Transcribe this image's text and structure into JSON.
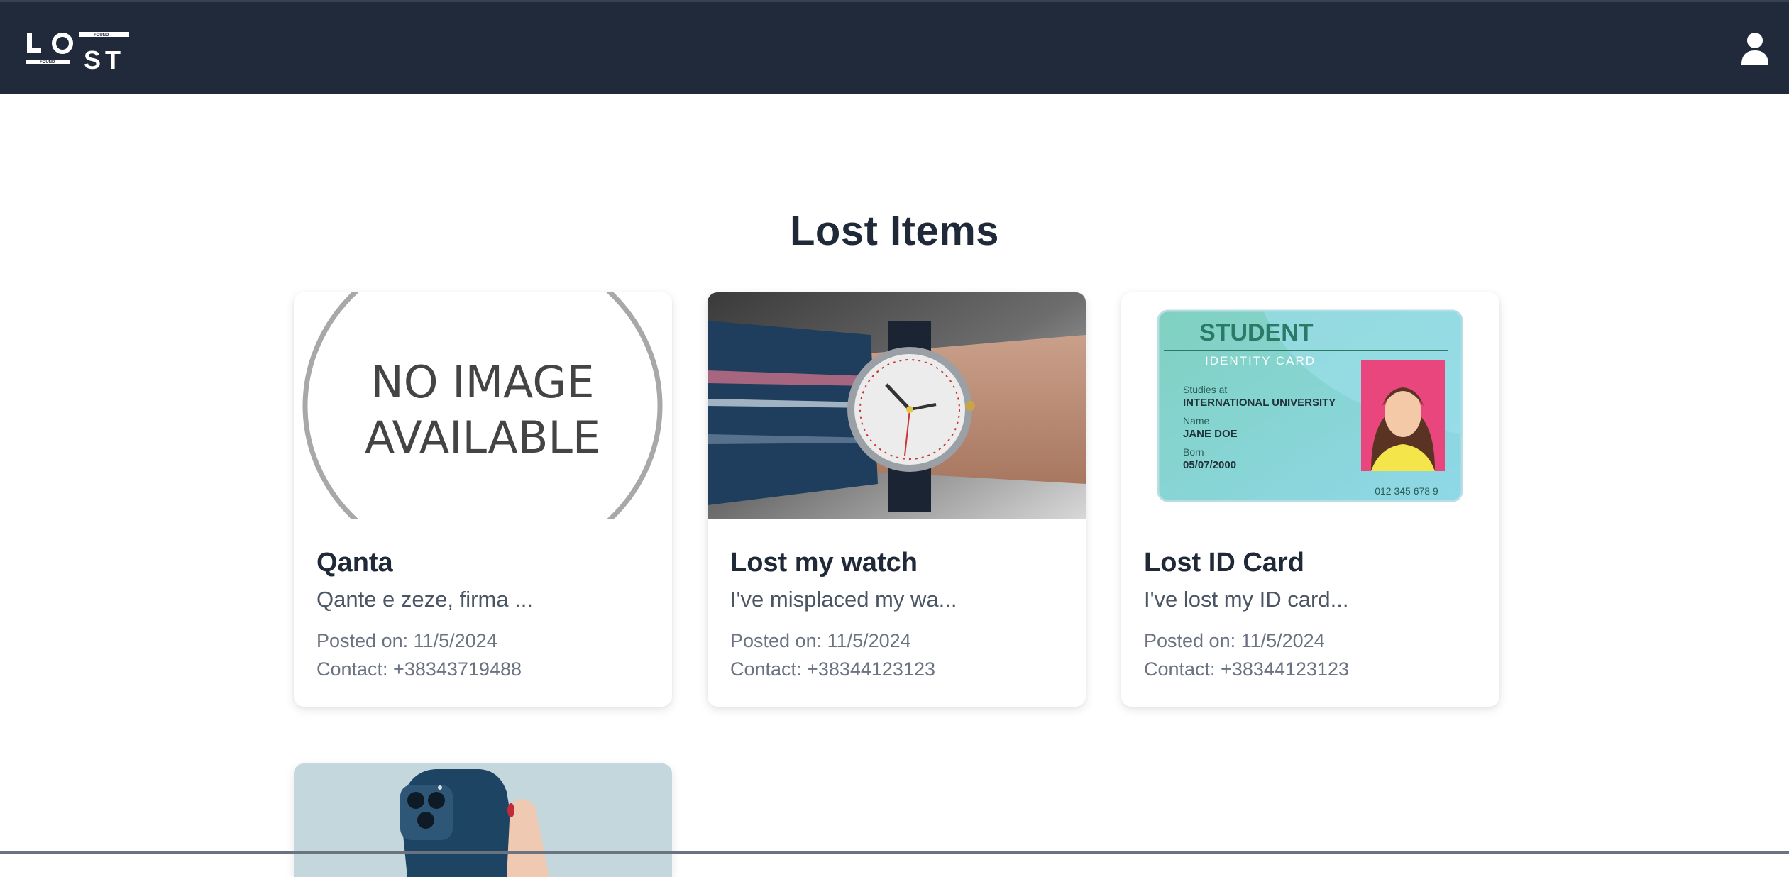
{
  "navbar": {
    "logo_text": "LOST",
    "logo_found_text": "FOUND",
    "user_icon": "user-icon"
  },
  "page": {
    "title": "Lost Items"
  },
  "items": [
    {
      "title": "Qanta",
      "description": "Qante e zeze, firma ...",
      "posted": "Posted on: 11/5/2024",
      "contact": "Contact: +38343719488",
      "image": "no-image",
      "no_image_line1": "NO IMAGE",
      "no_image_line2": "AVAILABLE"
    },
    {
      "title": "Lost my watch",
      "description": "I've misplaced my wa...",
      "posted": "Posted on: 11/5/2024",
      "contact": "Contact: +38344123123",
      "image": "watch-photo"
    },
    {
      "title": "Lost ID Card",
      "description": "I've lost my ID card...",
      "posted": "Posted on: 11/5/2024",
      "contact": "Contact: +38344123123",
      "image": "id-card-photo",
      "id_card": {
        "heading": "STUDENT",
        "subheading": "IDENTITY CARD",
        "studies_label": "Studies at",
        "studies_value": "INTERNATIONAL UNIVERSITY",
        "name_label": "Name",
        "name_value": "JANE DOE",
        "born_label": "Born",
        "born_value": "05/07/2000",
        "number": "012 345 678 9"
      }
    },
    {
      "image": "phone-photo"
    }
  ],
  "colors": {
    "navbar_bg": "#212a3a",
    "title_text": "#1f2937",
    "muted_text": "#6b7280"
  }
}
